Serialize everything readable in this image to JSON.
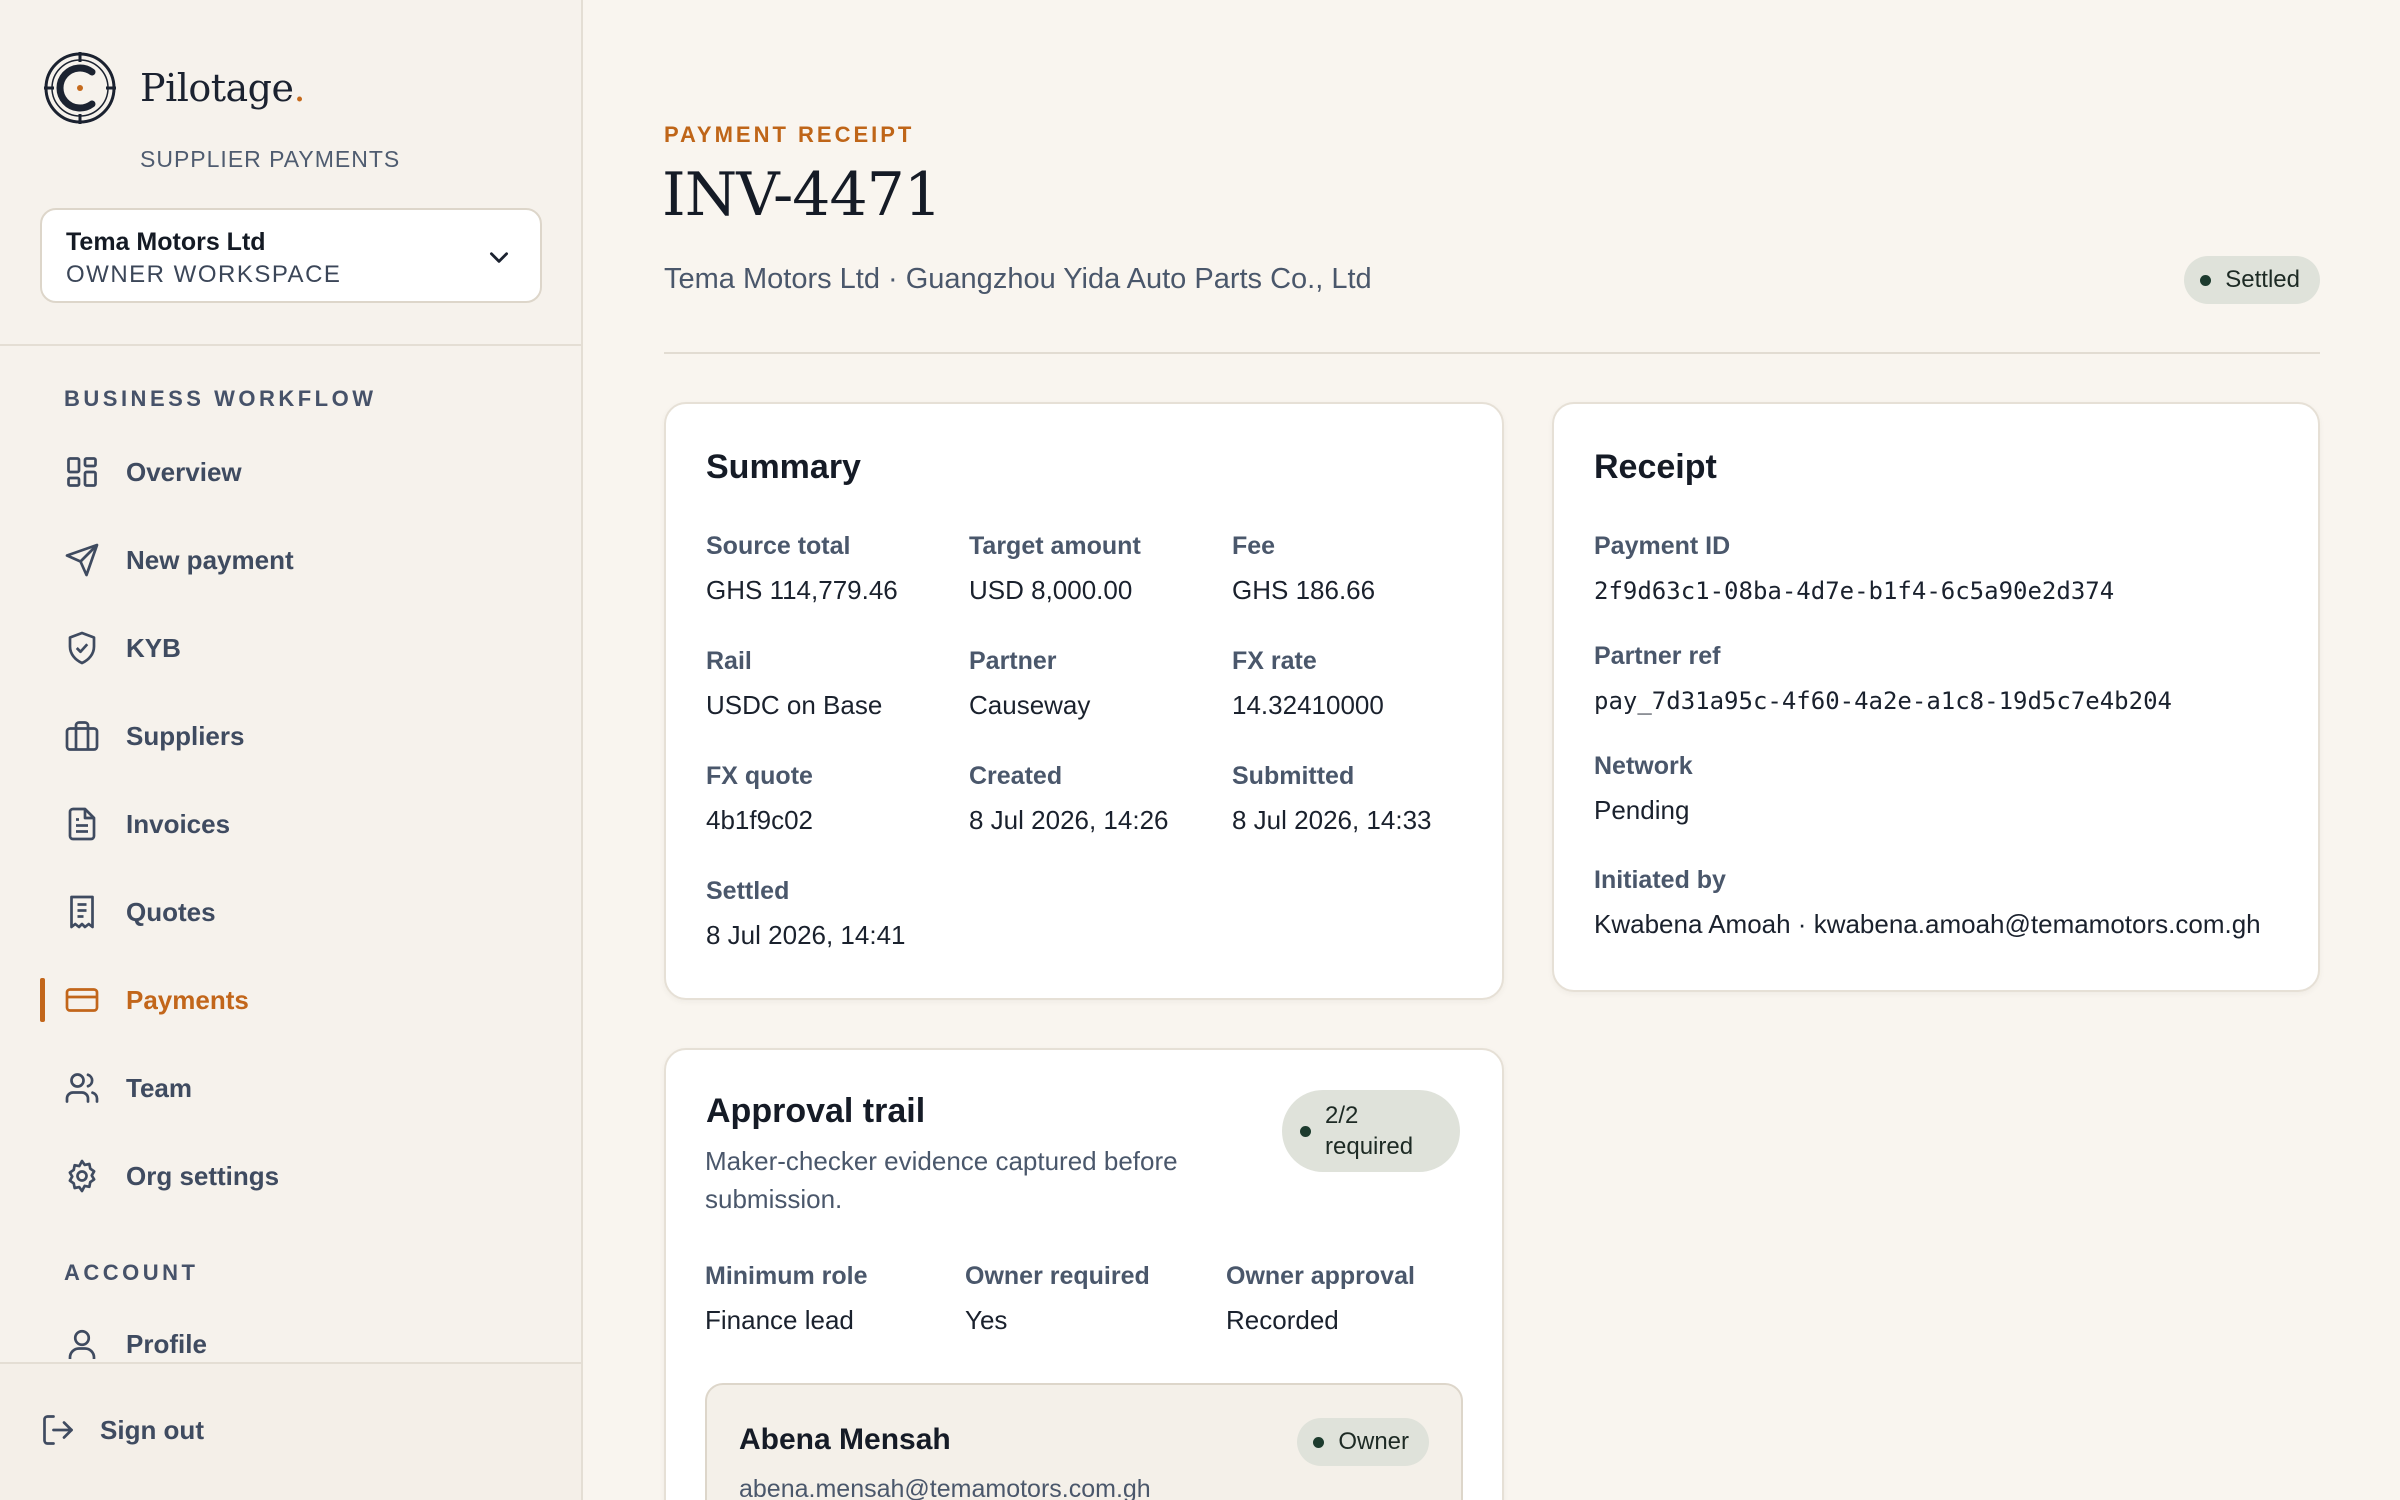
{
  "brand": {
    "name": "Pilotage",
    "dot": ".",
    "subtitle": "SUPPLIER PAYMENTS"
  },
  "workspace": {
    "name": "Tema Motors Ltd",
    "role": "OWNER WORKSPACE"
  },
  "nav": {
    "section_workflow": "BUSINESS WORKFLOW",
    "items": [
      {
        "label": "Overview",
        "icon": "grid-icon"
      },
      {
        "label": "New payment",
        "icon": "send-icon"
      },
      {
        "label": "KYB",
        "icon": "shield-check-icon"
      },
      {
        "label": "Suppliers",
        "icon": "briefcase-icon"
      },
      {
        "label": "Invoices",
        "icon": "document-icon"
      },
      {
        "label": "Quotes",
        "icon": "receipt-icon"
      },
      {
        "label": "Payments",
        "icon": "credit-card-icon",
        "active": true
      },
      {
        "label": "Team",
        "icon": "users-icon"
      },
      {
        "label": "Org settings",
        "icon": "gear-icon"
      }
    ],
    "section_account": "ACCOUNT",
    "account_items": [
      {
        "label": "Profile",
        "icon": "user-icon"
      }
    ],
    "signout": "Sign out"
  },
  "header": {
    "eyebrow": "PAYMENT RECEIPT",
    "title": "INV-4471",
    "parties": "Tema Motors Ltd · Guangzhou Yida Auto Parts Co., Ltd",
    "status": "Settled"
  },
  "summary": {
    "title": "Summary",
    "fields": [
      {
        "label": "Source total",
        "value": "GHS 114,779.46"
      },
      {
        "label": "Target amount",
        "value": "USD 8,000.00"
      },
      {
        "label": "Fee",
        "value": "GHS 186.66"
      },
      {
        "label": "Rail",
        "value": "USDC on Base"
      },
      {
        "label": "Partner",
        "value": "Causeway"
      },
      {
        "label": "FX rate",
        "value": "14.32410000"
      },
      {
        "label": "FX quote",
        "value": "4b1f9c02"
      },
      {
        "label": "Created",
        "value": "8 Jul 2026, 14:26"
      },
      {
        "label": "Submitted",
        "value": "8 Jul 2026, 14:33"
      },
      {
        "label": "Settled",
        "value": "8 Jul 2026, 14:41"
      }
    ]
  },
  "receipt": {
    "title": "Receipt",
    "fields": [
      {
        "label": "Payment ID",
        "value": "2f9d63c1-08ba-4d7e-b1f4-6c5a90e2d374"
      },
      {
        "label": "Partner ref",
        "value": "pay_7d31a95c-4f60-4a2e-a1c8-19d5c7e4b204"
      },
      {
        "label": "Network",
        "value": "Pending"
      },
      {
        "label": "Initiated by",
        "value": "Kwabena Amoah · kwabena.amoah@temamotors.com.gh"
      }
    ]
  },
  "approval": {
    "title": "Approval trail",
    "subtitle": "Maker-checker evidence captured before submission.",
    "required_line1": "2/2",
    "required_line2": "required",
    "fields": [
      {
        "label": "Minimum role",
        "value": "Finance lead"
      },
      {
        "label": "Owner required",
        "value": "Yes"
      },
      {
        "label": "Owner approval",
        "value": "Recorded"
      }
    ],
    "approvers": [
      {
        "name": "Abena Mensah",
        "email": "abena.mensah@temamotors.com.gh",
        "role": "Owner"
      }
    ]
  },
  "colors": {
    "accent": "#c2661a",
    "background": "#f9f5ef",
    "status_pill": "#dfe2da"
  }
}
